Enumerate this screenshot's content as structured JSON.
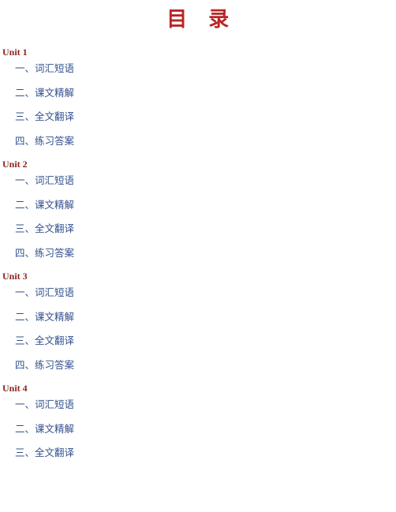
{
  "document": {
    "title": "目　录",
    "title_color": "#b92626",
    "unit_color": "#8d2420",
    "entry_color": "#32508e",
    "background_color": "#ffffff"
  },
  "units": [
    {
      "heading": "Unit 1",
      "entries": [
        "一、词汇短语",
        "二、课文精解",
        "三、全文翻译",
        "四、练习答案"
      ]
    },
    {
      "heading": "Unit 2",
      "entries": [
        "一、词汇短语",
        "二、课文精解",
        "三、全文翻译",
        "四、练习答案"
      ]
    },
    {
      "heading": "Unit 3",
      "entries": [
        "一、词汇短语",
        "二、课文精解",
        "三、全文翻译",
        "四、练习答案"
      ]
    },
    {
      "heading": "Unit 4",
      "entries": [
        "一、词汇短语",
        "二、课文精解",
        "三、全文翻译"
      ]
    }
  ]
}
